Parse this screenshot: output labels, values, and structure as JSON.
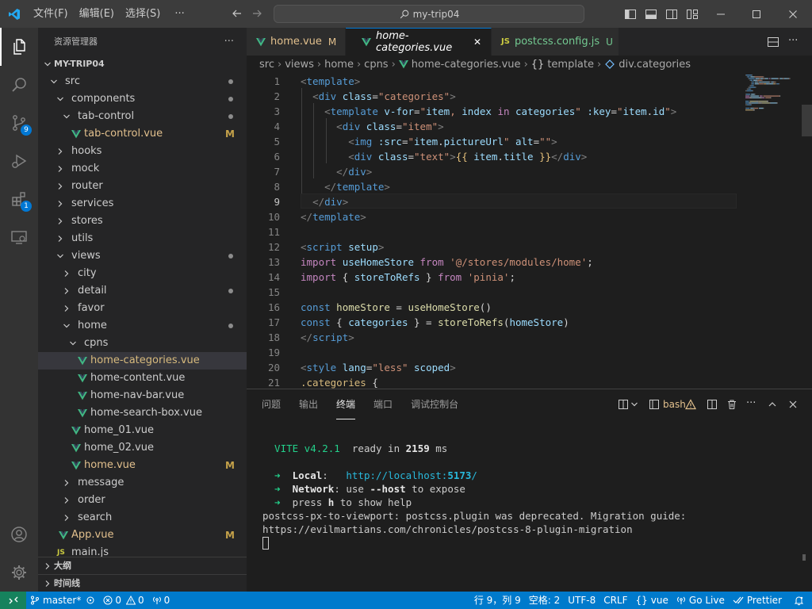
{
  "titlebar": {
    "menus": [
      "文件(F)",
      "编辑(E)",
      "选择(S)"
    ],
    "more": "···",
    "search": "my-trip04"
  },
  "activity": {
    "scm_badge": "9",
    "extensions_badge": "1"
  },
  "sidebar": {
    "title": "资源管理器",
    "more": "···",
    "project": "MY-TRIP04",
    "items": [
      {
        "label": "src",
        "level": 1,
        "expanded": true,
        "dot": true
      },
      {
        "label": "components",
        "level": 2,
        "expanded": true,
        "dot": true
      },
      {
        "label": "tab-control",
        "level": 3,
        "expanded": true,
        "dot": true
      },
      {
        "label": "tab-control.vue",
        "level": 4,
        "file": true,
        "mark": "M"
      },
      {
        "label": "hooks",
        "level": 2,
        "expanded": false
      },
      {
        "label": "mock",
        "level": 2,
        "expanded": false
      },
      {
        "label": "router",
        "level": 2,
        "expanded": false
      },
      {
        "label": "services",
        "level": 2,
        "expanded": false
      },
      {
        "label": "stores",
        "level": 2,
        "expanded": false
      },
      {
        "label": "utils",
        "level": 2,
        "expanded": false
      },
      {
        "label": "views",
        "level": 2,
        "expanded": true,
        "dot": true
      },
      {
        "label": "city",
        "level": 3,
        "expanded": false
      },
      {
        "label": "detail",
        "level": 3,
        "expanded": false,
        "dot": true
      },
      {
        "label": "favor",
        "level": 3,
        "expanded": false
      },
      {
        "label": "home",
        "level": 3,
        "expanded": true,
        "dot": true
      },
      {
        "label": "cpns",
        "level": 4,
        "expanded": true
      },
      {
        "label": "home-categories.vue",
        "level": 5,
        "file": true,
        "selected": true
      },
      {
        "label": "home-content.vue",
        "level": 5,
        "file": true
      },
      {
        "label": "home-nav-bar.vue",
        "level": 5,
        "file": true
      },
      {
        "label": "home-search-box.vue",
        "level": 5,
        "file": true
      },
      {
        "label": "home_01.vue",
        "level": 4,
        "file": true
      },
      {
        "label": "home_02.vue",
        "level": 4,
        "file": true
      },
      {
        "label": "home.vue",
        "level": 4,
        "file": true,
        "mark": "M"
      },
      {
        "label": "message",
        "level": 3,
        "expanded": false
      },
      {
        "label": "order",
        "level": 3,
        "expanded": false
      },
      {
        "label": "search",
        "level": 3,
        "expanded": false
      },
      {
        "label": "App.vue",
        "level": 2,
        "file": true,
        "mark": "M"
      },
      {
        "label": "main.js",
        "level": 2,
        "jsfile": true
      }
    ],
    "outline": "大纲",
    "timeline": "时间线"
  },
  "tabs": [
    {
      "label": "home.vue",
      "mark": "M",
      "icon": "vue-icon"
    },
    {
      "label": "home-categories.vue",
      "active": true,
      "icon": "vue-icon",
      "close": "✕"
    },
    {
      "label": "postcss.config.js",
      "mark": "U",
      "icon": "js-icon"
    }
  ],
  "breadcrumb": [
    "src",
    "views",
    "home",
    "cpns",
    "home-categories.vue",
    "template",
    "div.categories"
  ],
  "editor": {
    "current_line": 9,
    "line_numbers": [
      "1",
      "2",
      "3",
      "4",
      "5",
      "6",
      "7",
      "8",
      "9",
      "10",
      "11",
      "12",
      "13",
      "14",
      "15",
      "16",
      "17",
      "18",
      "19",
      "20",
      "21"
    ],
    "lines": [
      [
        [
          "br",
          "<"
        ],
        [
          "tg",
          "template"
        ],
        [
          "br",
          ">"
        ]
      ],
      [
        [
          "pl",
          "  "
        ],
        [
          "br",
          "<"
        ],
        [
          "tg",
          "div"
        ],
        [
          "pl",
          " "
        ],
        [
          "at",
          "class"
        ],
        [
          "pl",
          "="
        ],
        [
          "st",
          "\"categories\""
        ],
        [
          "br",
          ">"
        ]
      ],
      [
        [
          "pl",
          "    "
        ],
        [
          "br",
          "<"
        ],
        [
          "tg",
          "template"
        ],
        [
          "pl",
          " "
        ],
        [
          "at",
          "v-for"
        ],
        [
          "pl",
          "="
        ],
        [
          "st",
          "\""
        ],
        [
          "vr",
          "item"
        ],
        [
          "st",
          ", "
        ],
        [
          "vr",
          "index"
        ],
        [
          "st",
          " "
        ],
        [
          "kw",
          "in"
        ],
        [
          "st",
          " "
        ],
        [
          "vr",
          "categories"
        ],
        [
          "st",
          "\""
        ],
        [
          "pl",
          " "
        ],
        [
          "at",
          ":key"
        ],
        [
          "pl",
          "="
        ],
        [
          "st",
          "\""
        ],
        [
          "vr",
          "item"
        ],
        [
          "pl",
          "."
        ],
        [
          "vr",
          "id"
        ],
        [
          "st",
          "\""
        ],
        [
          "br",
          ">"
        ]
      ],
      [
        [
          "pl",
          "      "
        ],
        [
          "br",
          "<"
        ],
        [
          "tg",
          "div"
        ],
        [
          "pl",
          " "
        ],
        [
          "at",
          "class"
        ],
        [
          "pl",
          "="
        ],
        [
          "st",
          "\"item\""
        ],
        [
          "br",
          ">"
        ]
      ],
      [
        [
          "pl",
          "        "
        ],
        [
          "br",
          "<"
        ],
        [
          "tg",
          "img"
        ],
        [
          "pl",
          " "
        ],
        [
          "at",
          ":src"
        ],
        [
          "pl",
          "="
        ],
        [
          "st",
          "\""
        ],
        [
          "vr",
          "item"
        ],
        [
          "pl",
          "."
        ],
        [
          "vr",
          "pictureUrl"
        ],
        [
          "st",
          "\""
        ],
        [
          "pl",
          " "
        ],
        [
          "at",
          "alt"
        ],
        [
          "pl",
          "="
        ],
        [
          "st",
          "\"\""
        ],
        [
          "br",
          ">"
        ]
      ],
      [
        [
          "pl",
          "        "
        ],
        [
          "br",
          "<"
        ],
        [
          "tg",
          "div"
        ],
        [
          "pl",
          " "
        ],
        [
          "at",
          "class"
        ],
        [
          "pl",
          "="
        ],
        [
          "st",
          "\"text\""
        ],
        [
          "br",
          ">"
        ],
        [
          "mus",
          "{{ "
        ],
        [
          "vr",
          "item"
        ],
        [
          "pl",
          "."
        ],
        [
          "vr",
          "title"
        ],
        [
          "mus",
          " }}"
        ],
        [
          "br",
          "</"
        ],
        [
          "tg",
          "div"
        ],
        [
          "br",
          ">"
        ]
      ],
      [
        [
          "pl",
          "      "
        ],
        [
          "br",
          "</"
        ],
        [
          "tg",
          "div"
        ],
        [
          "br",
          ">"
        ]
      ],
      [
        [
          "pl",
          "    "
        ],
        [
          "br",
          "</"
        ],
        [
          "tg",
          "template"
        ],
        [
          "br",
          ">"
        ]
      ],
      [
        [
          "pl",
          "  "
        ],
        [
          "br",
          "</"
        ],
        [
          "tg",
          "div"
        ],
        [
          "br",
          ">"
        ]
      ],
      [
        [
          "br",
          "</"
        ],
        [
          "tg",
          "template"
        ],
        [
          "br",
          ">"
        ]
      ],
      [],
      [
        [
          "br",
          "<"
        ],
        [
          "tg",
          "script"
        ],
        [
          "pl",
          " "
        ],
        [
          "at",
          "setup"
        ],
        [
          "br",
          ">"
        ]
      ],
      [
        [
          "kw",
          "import"
        ],
        [
          "pl",
          " "
        ],
        [
          "vr",
          "useHomeStore"
        ],
        [
          "pl",
          " "
        ],
        [
          "kw",
          "from"
        ],
        [
          "pl",
          " "
        ],
        [
          "st",
          "'@/stores/modules/home'"
        ],
        [
          "pl",
          ";"
        ]
      ],
      [
        [
          "kw",
          "import"
        ],
        [
          "pl",
          " { "
        ],
        [
          "vr",
          "storeToRefs"
        ],
        [
          "pl",
          " } "
        ],
        [
          "kw",
          "from"
        ],
        [
          "pl",
          " "
        ],
        [
          "st",
          "'pinia'"
        ],
        [
          "pl",
          ";"
        ]
      ],
      [],
      [
        [
          "tg",
          "const"
        ],
        [
          "pl",
          " "
        ],
        [
          "fn",
          "homeStore"
        ],
        [
          "pl",
          " = "
        ],
        [
          "fn",
          "useHomeStore"
        ],
        [
          "pl",
          "()"
        ]
      ],
      [
        [
          "tg",
          "const"
        ],
        [
          "pl",
          " { "
        ],
        [
          "vr",
          "categories"
        ],
        [
          "pl",
          " } = "
        ],
        [
          "fn",
          "storeToRefs"
        ],
        [
          "pl",
          "("
        ],
        [
          "vr",
          "homeStore"
        ],
        [
          "pl",
          ")"
        ]
      ],
      [
        [
          "br",
          "</"
        ],
        [
          "tg",
          "script"
        ],
        [
          "br",
          ">"
        ]
      ],
      [],
      [
        [
          "br",
          "<"
        ],
        [
          "tg",
          "style"
        ],
        [
          "pl",
          " "
        ],
        [
          "at",
          "lang"
        ],
        [
          "pl",
          "="
        ],
        [
          "st",
          "\"less\""
        ],
        [
          "pl",
          " "
        ],
        [
          "at",
          "scoped"
        ],
        [
          "br",
          ">"
        ]
      ],
      [
        [
          "sel",
          ".categories"
        ],
        [
          "pl",
          " {"
        ]
      ]
    ]
  },
  "panel": {
    "tabs": [
      "问题",
      "输出",
      "终端",
      "端口",
      "调试控制台"
    ],
    "active_tab": "终端",
    "shell": "bash",
    "terminal": [
      [],
      [
        [
          "grn",
          "  VITE v4.2.1"
        ],
        [
          "pl",
          "  ready in "
        ],
        [
          "wht",
          "2159"
        ],
        [
          "pl",
          " ms"
        ]
      ],
      [],
      [
        [
          "grn",
          "  ➜ "
        ],
        [
          "wht",
          " Local"
        ],
        [
          "pl",
          ":   "
        ],
        [
          "cyn",
          "http://localhost:"
        ],
        [
          "cynb",
          "5173"
        ],
        [
          "cyn",
          "/"
        ]
      ],
      [
        [
          "grn",
          "  ➜ "
        ],
        [
          "wht",
          " Network"
        ],
        [
          "pl",
          ": use "
        ],
        [
          "wht",
          "--host"
        ],
        [
          "pl",
          " to expose"
        ]
      ],
      [
        [
          "grn",
          "  ➜ "
        ],
        [
          "pl",
          " press "
        ],
        [
          "wht",
          "h"
        ],
        [
          "pl",
          " to show help"
        ]
      ],
      [
        [
          "pl",
          "postcss-px-to-viewport: postcss.plugin was deprecated. Migration guide:"
        ]
      ],
      [
        [
          "pl",
          "https://evilmartians.com/chronicles/postcss-8-plugin-migration"
        ]
      ]
    ]
  },
  "status": {
    "branch": "master*",
    "errors": "0",
    "warnings": "0",
    "ports": "0",
    "position": "行 9，列 9",
    "spaces": "空格: 2",
    "encoding": "UTF-8",
    "eol": "CRLF",
    "language": "vue",
    "golive": "Go Live",
    "prettier": "Prettier"
  }
}
